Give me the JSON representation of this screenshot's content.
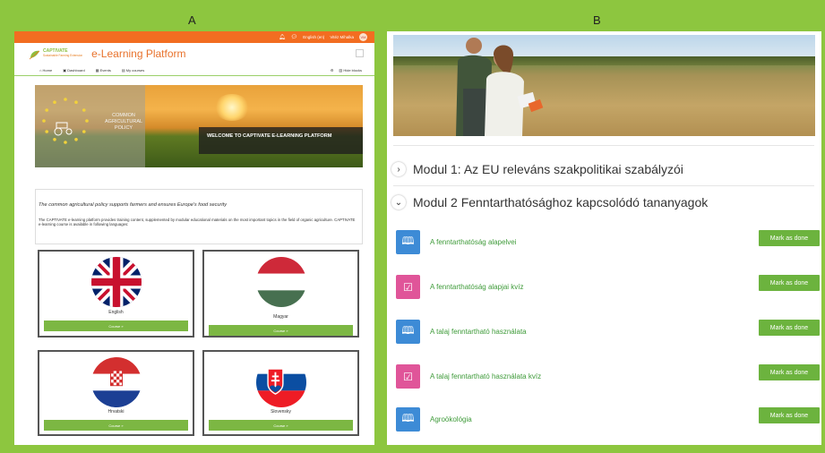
{
  "labels": {
    "a": "A",
    "b": "B"
  },
  "panelA": {
    "topbar": {
      "language": "English (en)",
      "user": "Vitéz Mihalka"
    },
    "header": {
      "brand": "CAPTIVATE",
      "brand_sub": "Sustainable Farming Extension",
      "title": "e-Learning Platform"
    },
    "nav": {
      "items": [
        "Home",
        "Dashboard",
        "Events",
        "My courses"
      ],
      "right": "Hide blocks"
    },
    "banner": {
      "left_text": "COMMON AGRICULTURAL POLICY",
      "welcome": "WELCOME TO CAPTIVATE E-LEARNING PLATFORM"
    },
    "intro": {
      "italic": "The common agricultural policy supports farmers and ensures Europe's food security",
      "paragraph": "The CAPTIVATE e-learning platform provides training content, supplemented by modular educational materials on the most important topics in the field of organic agriculture. CAPTIVATE e-learning course is available in following languages:"
    },
    "languages": [
      {
        "name": "English",
        "button": "Course »"
      },
      {
        "name": "Magyar",
        "button": "Course »"
      },
      {
        "name": "Hrvatski",
        "button": "Course »"
      },
      {
        "name": "Slovensky",
        "button": "Course »"
      }
    ]
  },
  "panelB": {
    "modules": [
      {
        "title": "Modul 1: Az EU releváns szakpolitikai szabályzói",
        "expanded": false
      },
      {
        "title": "Modul 2 Fenntarthatósághoz kapcsolódó tananyagok",
        "expanded": true
      }
    ],
    "activities": [
      {
        "name": "A fenntarthatóság alapelvei",
        "icon": "book-icon",
        "button": "Mark as done"
      },
      {
        "name": "A fenntarthatóság alapjai kvíz",
        "icon": "quiz-icon",
        "button": "Mark as done"
      },
      {
        "name": "A talaj fenntartható használata",
        "icon": "book-icon",
        "button": "Mark as done"
      },
      {
        "name": "A talaj fenntartható használata kvíz",
        "icon": "quiz-icon",
        "button": "Mark as done"
      },
      {
        "name": "Agroökológia",
        "icon": "book-icon",
        "button": "Mark as done"
      }
    ]
  },
  "colors": {
    "accent_orange": "#f26d21",
    "brand_green": "#7cb743",
    "background": "#8dc63f"
  }
}
